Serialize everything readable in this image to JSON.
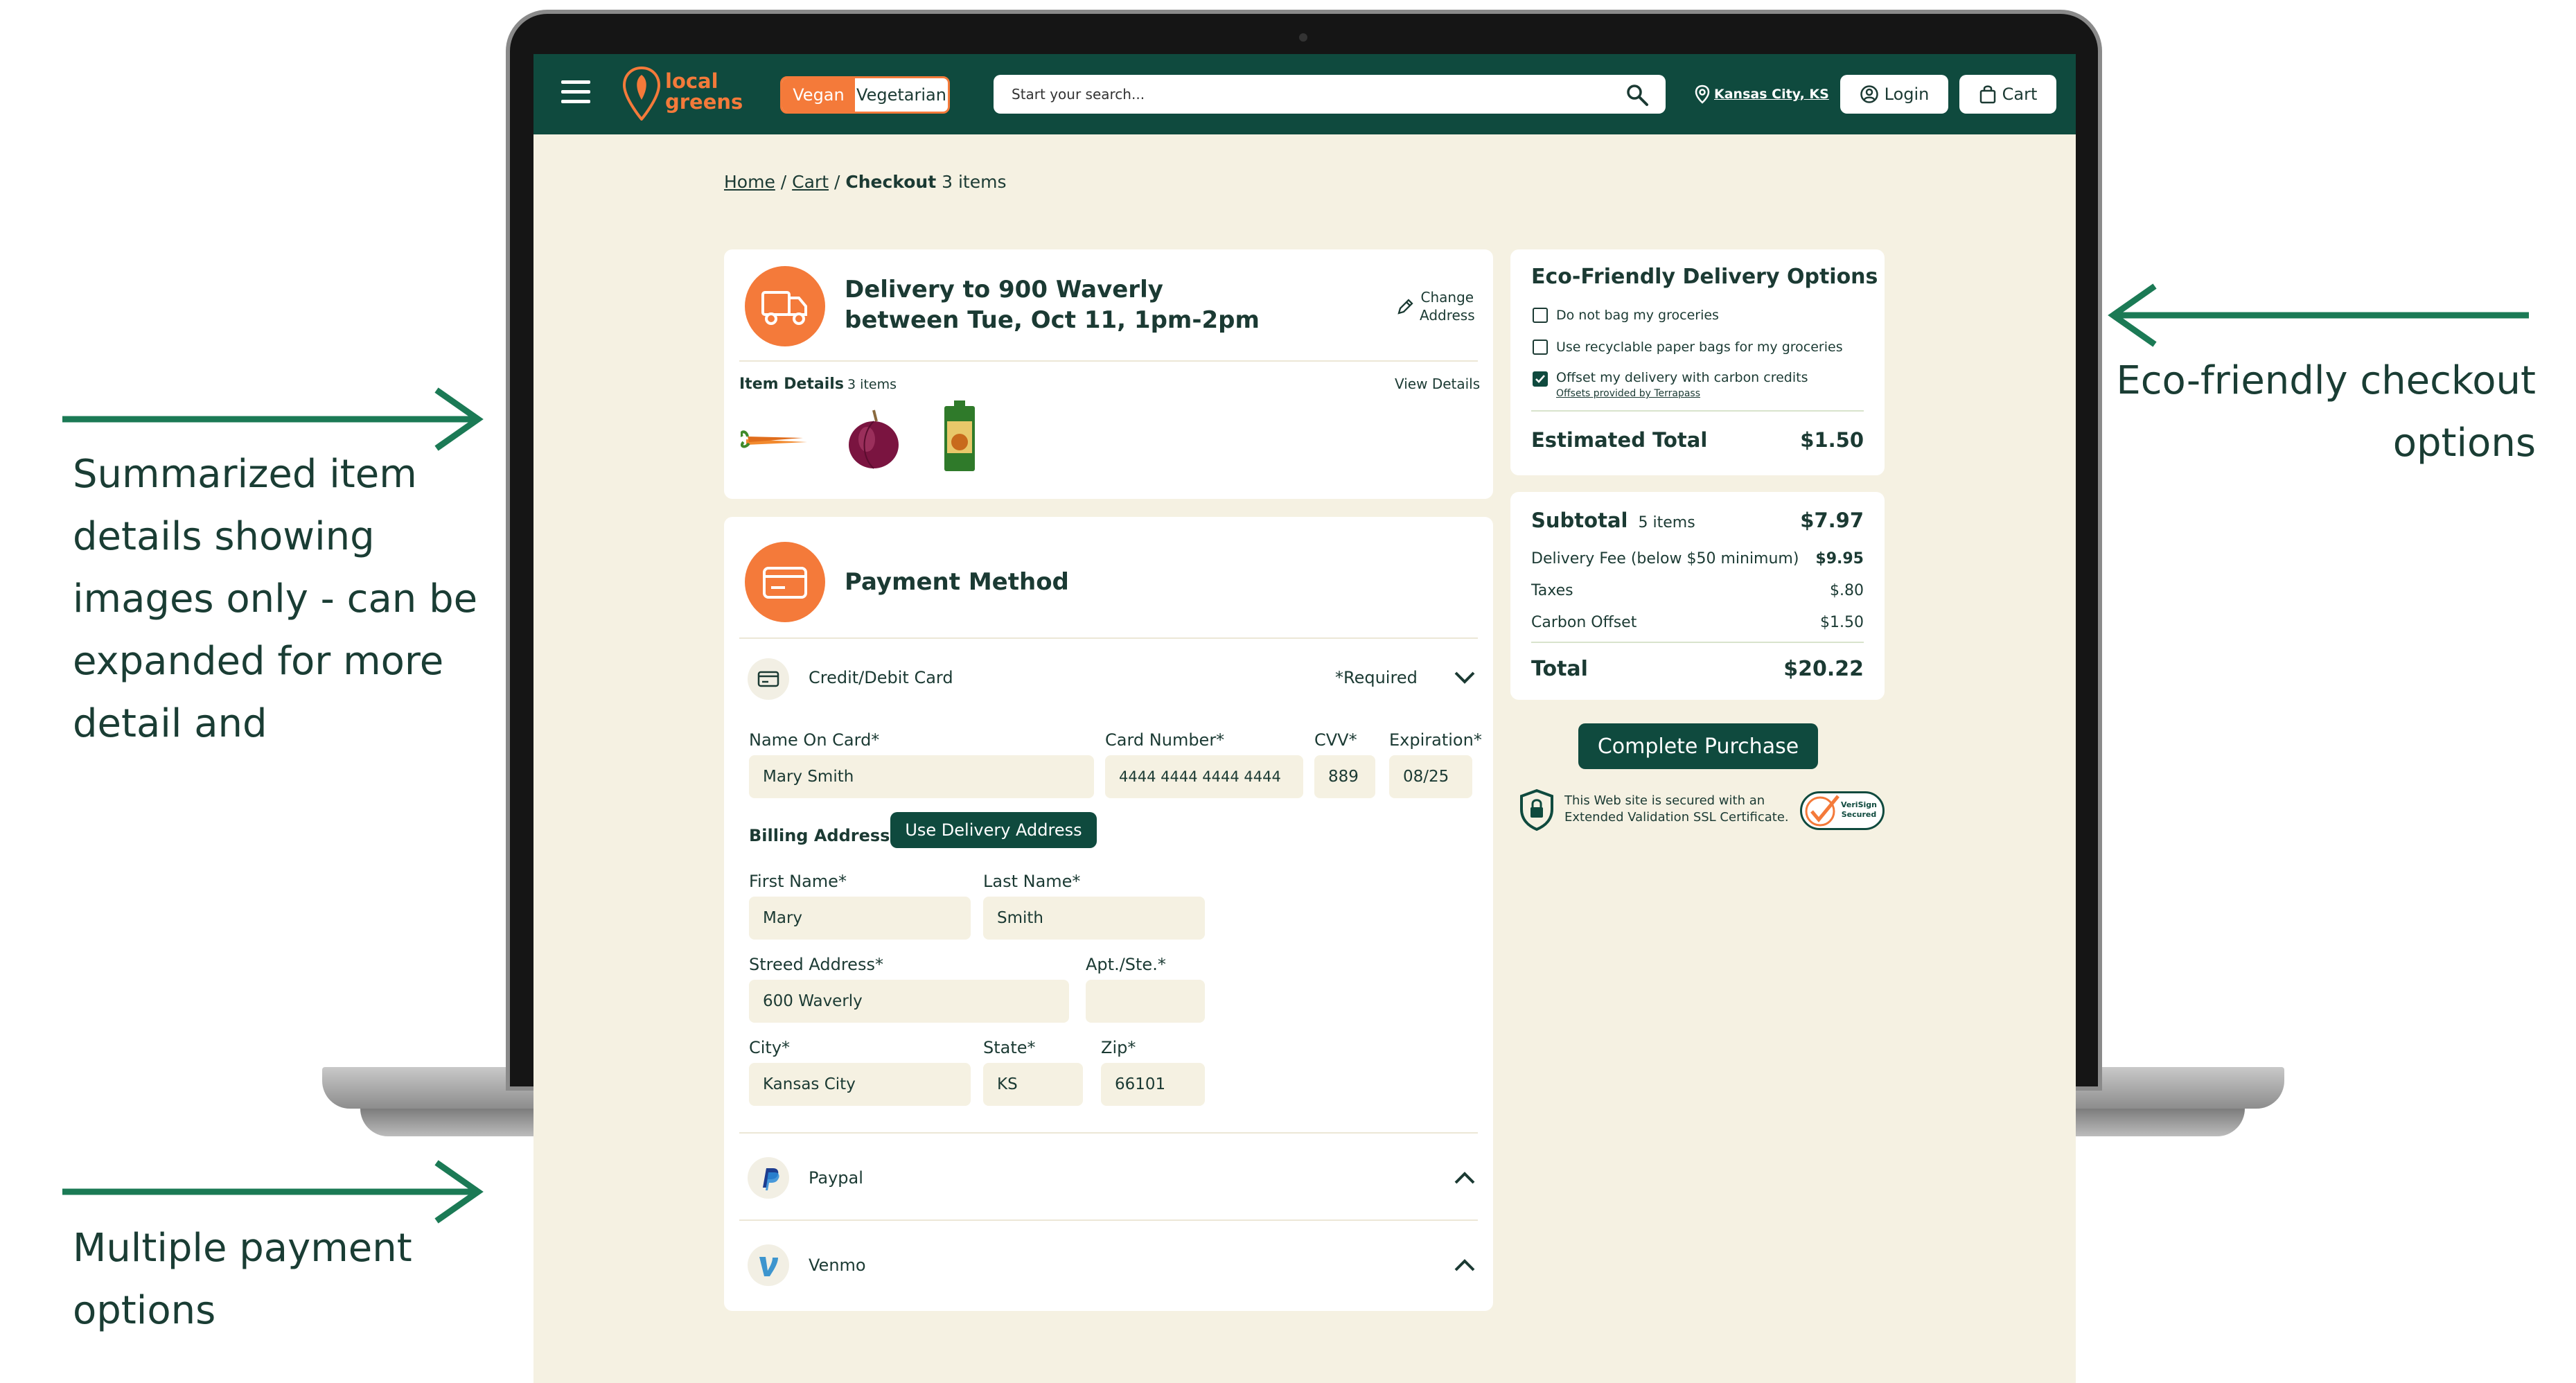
{
  "annotations": {
    "eco": [
      "Eco-friendly checkout",
      "options"
    ],
    "summary": [
      "Summarized item",
      "details showing",
      "images only - can be",
      "expanded for more",
      "detail and"
    ],
    "payment": [
      "Multiple payment",
      "options"
    ]
  },
  "navbar": {
    "logo_line1": "local",
    "logo_line2": "greens",
    "diet_vegan": "Vegan",
    "diet_vegetarian": "Vegetarian",
    "search_placeholder": "Start your search...",
    "location": "Kansas City, KS",
    "login": "Login",
    "cart": "Cart"
  },
  "breadcrumb": {
    "home": "Home",
    "cart": "Cart",
    "current": "Checkout",
    "count": "3 items"
  },
  "delivery": {
    "line1": "Delivery to 900 Waverly",
    "line2": "between Tue, Oct 11, 1pm-2pm",
    "change_line1": "Change",
    "change_line2": "Address",
    "item_details": "Item Details",
    "item_count": "3 items",
    "view_details": "View Details",
    "items": [
      "carrots-image",
      "red-onion-image",
      "broth-carton-image"
    ]
  },
  "payment": {
    "title": "Payment Method",
    "card_label": "Credit/Debit Card",
    "required": "*Required",
    "name_label": "Name On Card*",
    "name_value": "Mary Smith",
    "number_label": "Card Number*",
    "number_value": "4444 4444 4444 4444",
    "cvv_label": "CVV*",
    "cvv_value": "889",
    "exp_label": "Expiration*",
    "exp_value": "08/25",
    "billing_label": "Billing Address",
    "use_delivery": "Use Delivery Address",
    "first_label": "First Name*",
    "first_value": "Mary",
    "last_label": "Last Name*",
    "last_value": "Smith",
    "street_label": "Streed Address*",
    "street_value": "600 Waverly",
    "apt_label": "Apt./Ste.*",
    "apt_value": "",
    "city_label": "City*",
    "city_value": "Kansas City",
    "state_label": "State*",
    "state_value": "KS",
    "zip_label": "Zip*",
    "zip_value": "66101",
    "paypal": "Paypal",
    "venmo": "Venmo"
  },
  "eco": {
    "title": "Eco-Friendly Delivery Options",
    "opt1": "Do not bag my groceries",
    "opt1_checked": false,
    "opt2": "Use recyclable paper bags for my groceries",
    "opt2_checked": false,
    "opt3": "Offset my delivery with carbon credits",
    "opt3_checked": true,
    "opt3_sub": "Offsets provided by Terrapass",
    "estimated_label": "Estimated Total",
    "estimated_value": "$1.50"
  },
  "summary": {
    "subtotal_label": "Subtotal",
    "subtotal_count": "5 items",
    "subtotal_value": "$7.97",
    "delivery_label": "Delivery Fee (below $50 minimum)",
    "delivery_value": "$9.95",
    "taxes_label": "Taxes",
    "taxes_value": "$.80",
    "carbon_label": "Carbon Offset",
    "carbon_value": "$1.50",
    "total_label": "Total",
    "total_value": "$20.22",
    "purchase": "Complete Purchase",
    "ssl_line1": "This Web site is secured with an",
    "ssl_line2": "Extended Validation SSL Certificate.",
    "verisign_line1": "VeriSign",
    "verisign_line2": "Secured"
  },
  "colors": {
    "brand_green": "#0f4a3e",
    "accent_orange": "#f47a3a",
    "page_bg": "#f5f1e2"
  }
}
